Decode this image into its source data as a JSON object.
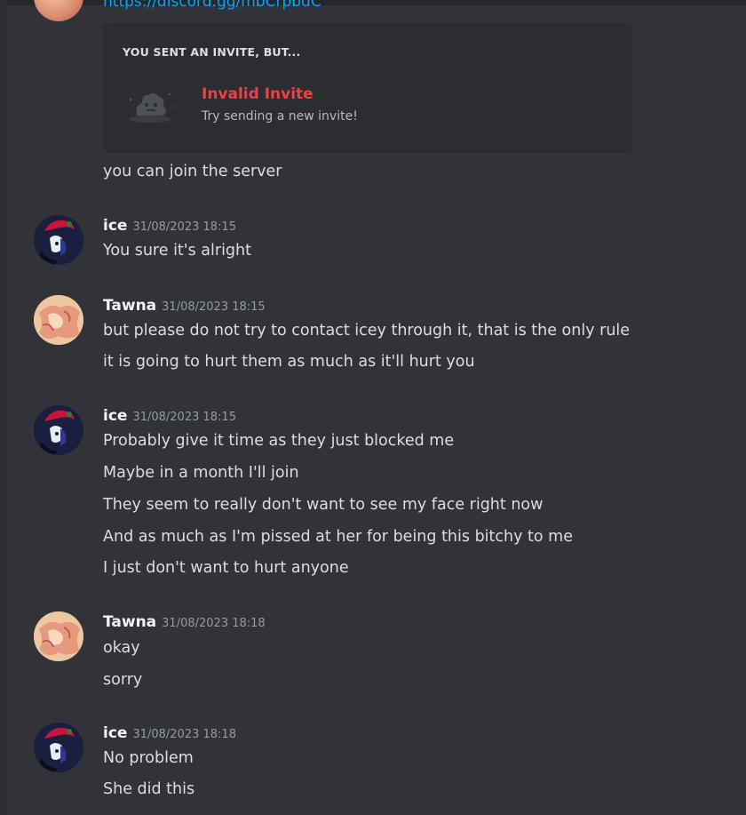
{
  "theme": {
    "background": "#313338",
    "card_background": "#2b2d31",
    "link_color": "#00a8fc",
    "invalid_color": "#f23f43",
    "text_color": "#dbdee1",
    "muted_color": "#949ba4"
  },
  "top_link": "https://discord.gg/mbCrpbdC",
  "invite": {
    "header": "YOU SENT AN INVITE, BUT...",
    "icon": "broken-invite-icon",
    "title": "Invalid Invite",
    "subtitle": "Try sending a new invite!"
  },
  "continuation": {
    "text": "you can join the server"
  },
  "messages": [
    {
      "author": "ice",
      "timestamp": "31/08/2023 18:15",
      "avatar": "ice-avatar",
      "lines": [
        "You sure it's alright"
      ]
    },
    {
      "author": "Tawna",
      "timestamp": "31/08/2023 18:15",
      "avatar": "tawna-avatar",
      "lines": [
        "but please do not try to contact icey through it, that is the only rule",
        "it is going to hurt them as much as it'll hurt you"
      ]
    },
    {
      "author": "ice",
      "timestamp": "31/08/2023 18:15",
      "avatar": "ice-avatar",
      "lines": [
        "Probably give it time as they just blocked me",
        "Maybe in a month I'll join",
        "They seem to really don't want to see my face right now",
        "And as much as I'm pissed at her for being this bitchy to me",
        "I just don't want to hurt anyone"
      ]
    },
    {
      "author": "Tawna",
      "timestamp": "31/08/2023 18:18",
      "avatar": "tawna-avatar",
      "lines": [
        "okay",
        "sorry"
      ]
    },
    {
      "author": "ice",
      "timestamp": "31/08/2023 18:18",
      "avatar": "ice-avatar",
      "lines": [
        "No problem",
        "She did this"
      ]
    }
  ]
}
